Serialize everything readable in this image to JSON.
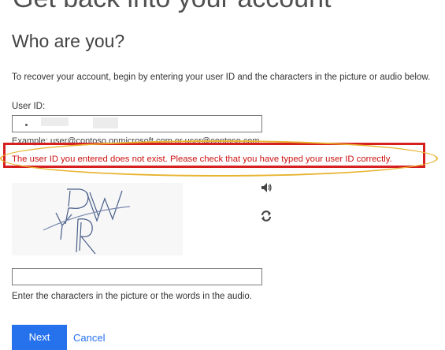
{
  "page": {
    "heading": "Get back into your account",
    "section_title": "Who are you?",
    "instruction": "To recover your account, begin by entering your user ID and the characters in the picture or audio below."
  },
  "user_id": {
    "label": "User ID:",
    "value": "",
    "example": "Example: user@contoso.onmicrosoft.com or user@contoso.com"
  },
  "error": {
    "message": "The user ID you entered does not exist. Please check that you have typed your user ID correctly.",
    "color": "#cc1111",
    "box_color": "#d61f1f",
    "highlight_color": "#e8b431"
  },
  "captcha": {
    "characters": "PWYR",
    "audio_icon": "speaker-icon",
    "refresh_icon": "refresh-icon",
    "input_value": "",
    "hint": "Enter the characters in the picture or the words in the audio."
  },
  "actions": {
    "next_label": "Next",
    "cancel_label": "Cancel",
    "accent": "#2672ec"
  }
}
